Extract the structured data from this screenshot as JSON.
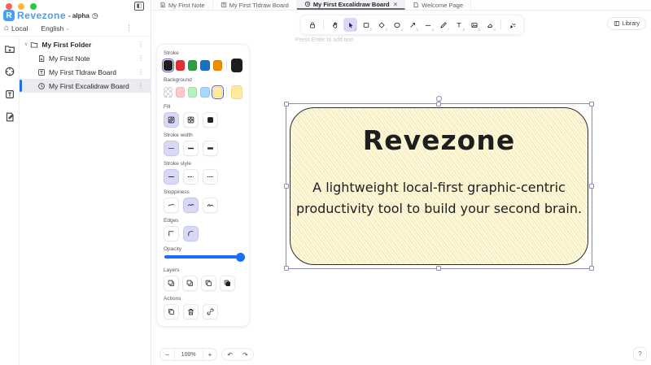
{
  "window": {
    "app_name": "Revezone",
    "logo_letter": "R",
    "version": "- alpha",
    "workspace": "Local",
    "language": "English"
  },
  "sidebar": {
    "folder": "My First Folder",
    "items": [
      {
        "label": "My First Note",
        "icon": "note"
      },
      {
        "label": "My First Tldraw Board",
        "icon": "tldraw"
      },
      {
        "label": "My First Excalidraw Board",
        "icon": "excalidraw",
        "selected": true
      }
    ]
  },
  "tabs": [
    {
      "label": "My First Note"
    },
    {
      "label": "My First Tldraw Board"
    },
    {
      "label": "My First Excalidraw Board",
      "active": true
    },
    {
      "label": "Welcome Page"
    }
  ],
  "toolbar": {
    "hint": "Press Enter to add text",
    "library_label": "Library",
    "shortcuts": {
      "selection": "1",
      "rectangle": "2",
      "diamond": "3",
      "ellipse": "4",
      "arrow": "5",
      "line": "6",
      "draw": "7",
      "text": "8",
      "image": "9",
      "eraser": "0"
    }
  },
  "panel": {
    "stroke_label": "Stroke",
    "background_label": "Background",
    "fill_label": "Fill",
    "stroke_width_label": "Stroke width",
    "stroke_style_label": "Stroke style",
    "sloppiness_label": "Sloppiness",
    "edges_label": "Edges",
    "opacity_label": "Opacity",
    "layers_label": "Layers",
    "actions_label": "Actions"
  },
  "canvas_shape": {
    "title": "Revezone",
    "description_line1": "A lightweight local-first graphic-centric",
    "description_line2": "productivity tool to build your second brain."
  },
  "footer": {
    "zoom_level": "100%"
  },
  "glyphs": {
    "close": "×",
    "kebab": "⋮",
    "chevron": "⌄",
    "tree_chevron": "∨",
    "home": "⌂",
    "minus": "−",
    "plus": "+",
    "undo": "↶",
    "redo": "↷",
    "help": "?"
  },
  "colors": {
    "accent_blue": "#1b6ef3",
    "logo_blue": "#45a0f1",
    "traffic_red": "#ff5f57",
    "traffic_yellow": "#febc2e",
    "traffic_green": "#28c840",
    "active_tool_bg": "#d9d8f7",
    "stroke_palette": [
      "#1e1e1e",
      "#e03131",
      "#2f9e44",
      "#1971c2",
      "#f08c00"
    ],
    "current_stroke": "#1e1e1e",
    "background_palette": [
      "transparent",
      "#ffc9c9",
      "#b2f2bb",
      "#a5d8ff",
      "#ffec99"
    ],
    "current_background": "#ffec99",
    "shape_fill": "#fffbe6",
    "selection_outline": "#8a8ab8"
  }
}
